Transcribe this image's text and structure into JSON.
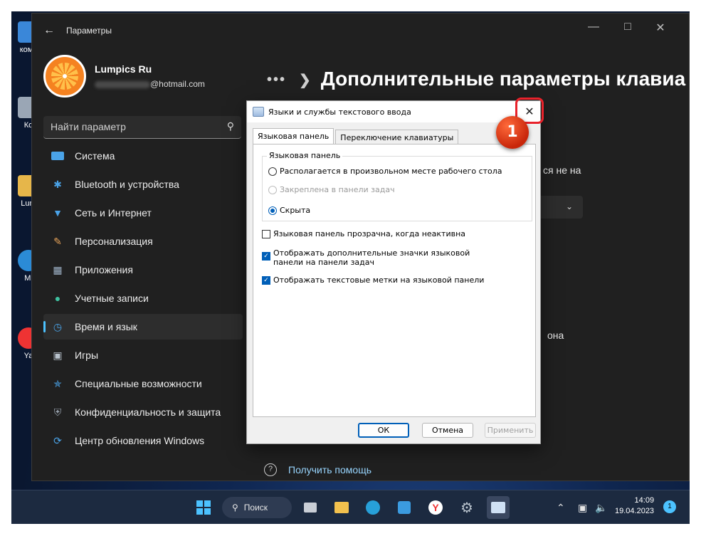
{
  "desktop": {
    "icons": [
      {
        "label": "комп"
      },
      {
        "label": "Ко"
      },
      {
        "label": "Lum"
      },
      {
        "label": "Mi"
      },
      {
        "label": "Ya"
      }
    ]
  },
  "settings": {
    "window_title": "Параметры",
    "profile": {
      "name": "Lumpics Ru",
      "email_visible": "@hotmail.com"
    },
    "search_placeholder": "Найти параметр",
    "nav": [
      {
        "label": "Система",
        "icon": "monitor-icon"
      },
      {
        "label": "Bluetooth и устройства",
        "icon": "bluetooth-icon"
      },
      {
        "label": "Сеть и Интернет",
        "icon": "wifi-icon"
      },
      {
        "label": "Персонализация",
        "icon": "brush-icon"
      },
      {
        "label": "Приложения",
        "icon": "apps-icon"
      },
      {
        "label": "Учетные записи",
        "icon": "person-icon"
      },
      {
        "label": "Время и язык",
        "icon": "globe-clock-icon",
        "active": true
      },
      {
        "label": "Игры",
        "icon": "gamepad-icon"
      },
      {
        "label": "Специальные возможности",
        "icon": "accessibility-icon"
      },
      {
        "label": "Конфиденциальность и защита",
        "icon": "shield-icon"
      },
      {
        "label": "Центр обновления Windows",
        "icon": "update-icon"
      }
    ],
    "page_heading": "Дополнительные параметры клавиа",
    "bg_text_1": "ся не на",
    "bg_text_2": "она",
    "help_link": "Получить помощь"
  },
  "dialog": {
    "title": "Языки и службы текстового ввода",
    "tabs": [
      "Языковая панель",
      "Переключение клавиатуры"
    ],
    "group_label": "Языковая панель",
    "radio_options": [
      {
        "label": "Располагается в произвольном месте рабочего стола",
        "checked": false,
        "disabled": false
      },
      {
        "label": "Закреплена в панели задач",
        "checked": false,
        "disabled": true
      },
      {
        "label": "Скрыта",
        "checked": true,
        "disabled": false
      }
    ],
    "checkboxes": [
      {
        "label": "Языковая панель прозрачна, когда неактивна",
        "checked": false
      },
      {
        "label": "Отображать дополнительные значки языковой панели на панели задач",
        "checked": true
      },
      {
        "label": "Отображать текстовые метки на языковой панели",
        "checked": true
      }
    ],
    "buttons": {
      "ok": "ОК",
      "cancel": "Отмена",
      "apply": "Применить"
    },
    "step_badge": "1"
  },
  "taskbar": {
    "search_label": "Поиск",
    "time": "14:09",
    "date": "19.04.2023",
    "notifications": "1"
  },
  "colors": {
    "accent": "#005fb8",
    "settings_accent": "#4cc2ff",
    "badge": "#e8222b"
  }
}
